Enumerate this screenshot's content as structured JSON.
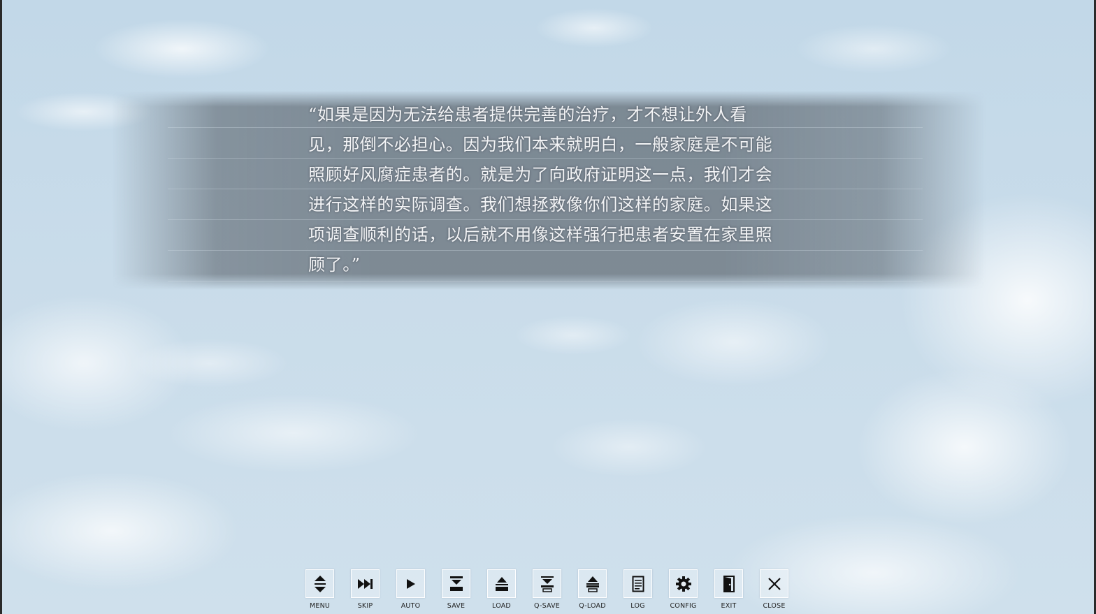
{
  "dialogue": {
    "lines": [
      "“如果是因为无法给患者提供完善的治疗，才不想让外人看",
      "见，那倒不必担心。因为我们本来就明白，一般家庭是不可能",
      "照顾好风腐症患者的。就是为了向政府证明这一点，我们才会",
      "进行这样的实际调查。我们想拯救像你们这样的家庭。如果这",
      "项调查顺利的话，以后就不用像这样强行把患者安置在家里照",
      "顾了。”"
    ]
  },
  "toolbar": {
    "buttons": [
      {
        "id": "menu",
        "label": "MENU",
        "icon": "menu-updown-icon"
      },
      {
        "id": "skip",
        "label": "SKIP",
        "icon": "fast-forward-icon"
      },
      {
        "id": "auto",
        "label": "AUTO",
        "icon": "play-icon"
      },
      {
        "id": "save",
        "label": "SAVE",
        "icon": "save-icon"
      },
      {
        "id": "load",
        "label": "LOAD",
        "icon": "load-icon"
      },
      {
        "id": "q-save",
        "label": "Q-SAVE",
        "icon": "quick-save-icon"
      },
      {
        "id": "q-load",
        "label": "Q-LOAD",
        "icon": "quick-load-icon"
      },
      {
        "id": "log",
        "label": "LOG",
        "icon": "log-document-icon"
      },
      {
        "id": "config",
        "label": "CONFIG",
        "icon": "gear-icon"
      },
      {
        "id": "exit",
        "label": "EXIT",
        "icon": "door-exit-icon"
      },
      {
        "id": "close",
        "label": "CLOSE",
        "icon": "close-icon"
      }
    ]
  }
}
